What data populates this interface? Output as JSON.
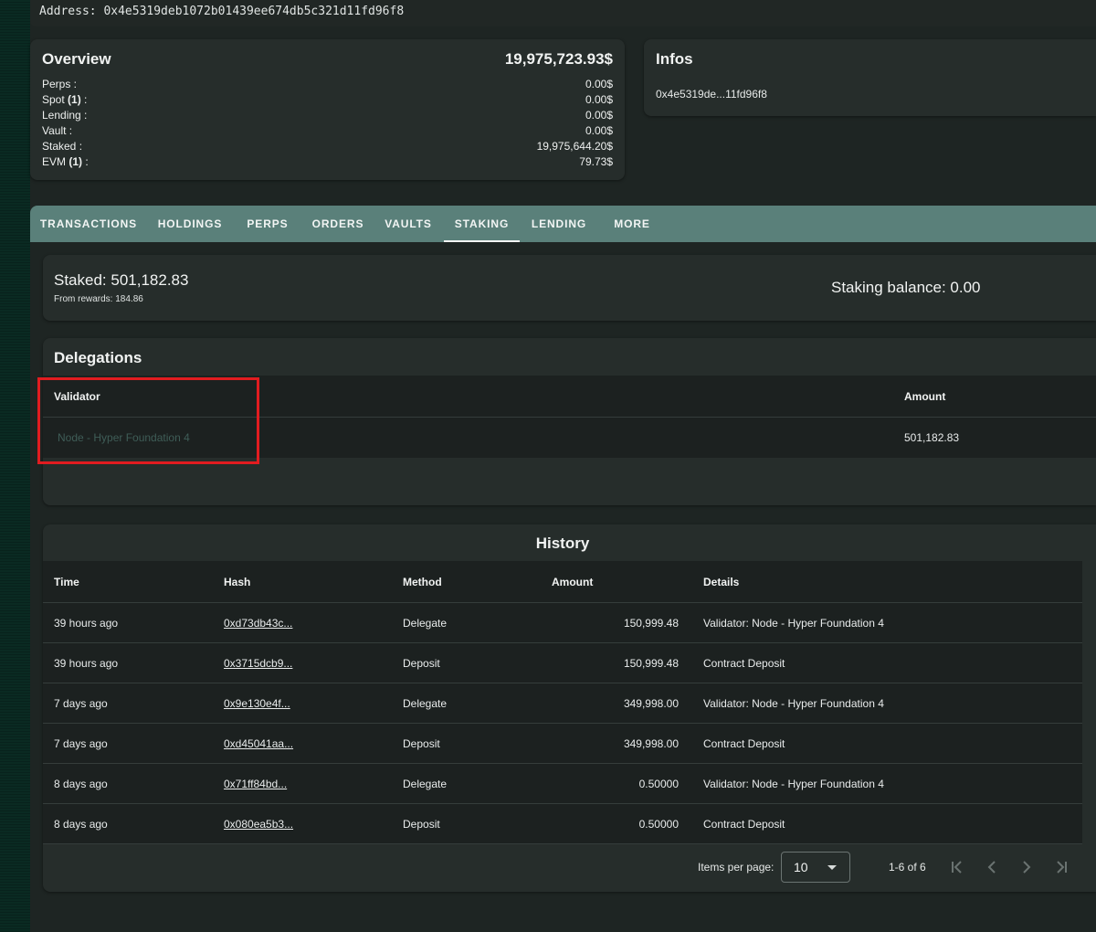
{
  "address_bar": {
    "text": "Address: 0x4e5319deb1072b01439ee674db5c321d11fd96f8"
  },
  "overview": {
    "title": "Overview",
    "total": "19,975,723.93$",
    "rows": [
      {
        "label": "Perps :",
        "value": "0.00$"
      },
      {
        "label": "Spot ",
        "count": "(1)",
        "suffix": " :",
        "value": "0.00$"
      },
      {
        "label": "Lending :",
        "value": "0.00$"
      },
      {
        "label": "Vault :",
        "value": "0.00$"
      },
      {
        "label": "Staked :",
        "value": "19,975,644.20$"
      },
      {
        "label": "EVM ",
        "count": "(1)",
        "suffix": " :",
        "value": "79.73$"
      }
    ]
  },
  "infos": {
    "title": "Infos",
    "address_short": "0x4e5319de...11fd96f8"
  },
  "tabs": [
    {
      "label": "TRANSACTIONS",
      "active": false
    },
    {
      "label": "HOLDINGS",
      "active": false
    },
    {
      "label": "PERPS",
      "active": false
    },
    {
      "label": "ORDERS",
      "active": false
    },
    {
      "label": "VAULTS",
      "active": false
    },
    {
      "label": "STAKING",
      "active": true
    },
    {
      "label": "LENDING",
      "active": false
    },
    {
      "label": "MORE",
      "active": false
    }
  ],
  "staking": {
    "staked": "Staked: 501,182.83",
    "from_rewards": "From rewards: 184.86",
    "balance": "Staking balance: 0.00"
  },
  "delegations": {
    "title": "Delegations",
    "columns": {
      "validator": "Validator",
      "amount": "Amount"
    },
    "rows": [
      {
        "validator": "Node - Hyper Foundation 4",
        "amount": "501,182.83"
      }
    ]
  },
  "history": {
    "title": "History",
    "columns": {
      "time": "Time",
      "hash": "Hash",
      "method": "Method",
      "amount": "Amount",
      "details": "Details"
    },
    "rows": [
      {
        "time": "39 hours ago",
        "hash": "0xd73db43c...",
        "method": "Delegate",
        "amount": "150,999.48",
        "details": "Validator: Node - Hyper Foundation 4"
      },
      {
        "time": "39 hours ago",
        "hash": "0x3715dcb9...",
        "method": "Deposit",
        "amount": "150,999.48",
        "details": "Contract Deposit"
      },
      {
        "time": "7 days ago",
        "hash": "0x9e130e4f...",
        "method": "Delegate",
        "amount": "349,998.00",
        "details": "Validator: Node - Hyper Foundation 4"
      },
      {
        "time": "7 days ago",
        "hash": "0xd45041aa...",
        "method": "Deposit",
        "amount": "349,998.00",
        "details": "Contract Deposit"
      },
      {
        "time": "8 days ago",
        "hash": "0x71ff84bd...",
        "method": "Delegate",
        "amount": "0.50000",
        "details": "Validator: Node - Hyper Foundation 4"
      },
      {
        "time": "8 days ago",
        "hash": "0x080ea5b3...",
        "method": "Deposit",
        "amount": "0.50000",
        "details": "Contract Deposit"
      }
    ],
    "pagination": {
      "items_per_page_label": "Items per page:",
      "items_per_page_value": "10",
      "range": "1-6 of 6"
    }
  },
  "colors": {
    "accent": "#5a807a",
    "link": "#3fb6a6",
    "highlight": "#e21c20"
  }
}
